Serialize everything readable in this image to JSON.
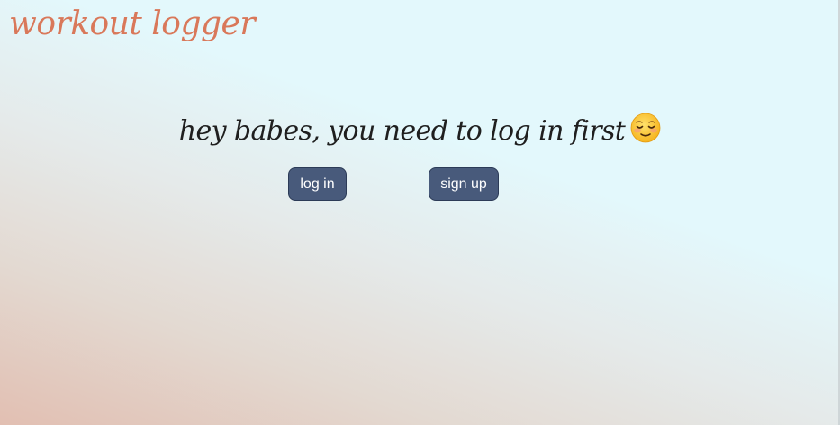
{
  "header": {
    "app_title": "workout logger"
  },
  "main": {
    "message": "hey babes, you need to log in first",
    "message_emoji": "relieved-face-icon",
    "login_label": "log in",
    "signup_label": "sign up"
  },
  "colors": {
    "title": "#d9785a",
    "button_bg": "#485a7b",
    "background_top": "#e3f8fc",
    "background_bottom": "#e2bfb2"
  }
}
